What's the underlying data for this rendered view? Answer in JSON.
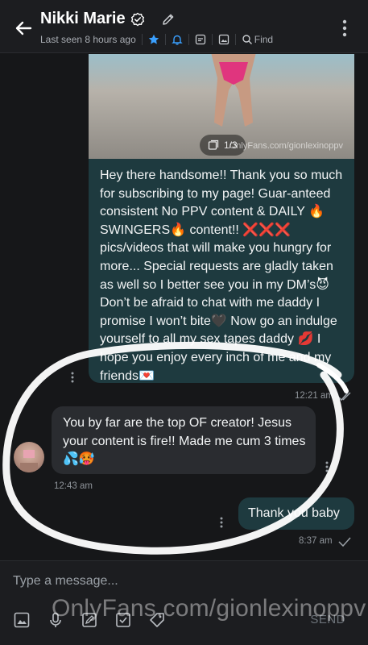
{
  "header": {
    "title": "Nikki Marie",
    "last_seen": "Last seen 8 hours ago",
    "find_label": "Find"
  },
  "media": {
    "counter": "1/3",
    "watermark": "OnlyFans.com/gionlexinoppv"
  },
  "messages": [
    {
      "direction": "outgoing",
      "text": "Hey there handsome!! Thank you so much for subscribing to my page! Guar-anteed consistent No PPV content & DAILY 🔥SWINGERS🔥 content!! ❌❌❌ pics/videos that will make you hungry for more... Special requests are gladly taken as well so I better see you in my DM’s😈 Don’t be afraid to chat with me daddy I promise I won’t bite🖤 Now go an indulge yourself to all my sex tapes daddy 💋 I hope you enjoy every inch of me and my friends💌",
      "time": "12:21 am"
    },
    {
      "direction": "incoming",
      "text": "You by far are the top OF creator! Jesus your content is fire!! Made me cum 3 times💦🥵",
      "time": "12:43 am"
    },
    {
      "direction": "outgoing",
      "text": "Thank you baby",
      "time": "8:37 am"
    }
  ],
  "composer": {
    "placeholder": "Type a message...",
    "send_label": "SEND"
  },
  "overlay_watermark": "OnlyFans.com/gionlexinoppv",
  "colors": {
    "background": "#161719",
    "outgoing_bubble": "#1e3a3f",
    "incoming_bubble": "#2a2c30",
    "accent": "#3aa0ff"
  },
  "icons": [
    "back-arrow-icon",
    "verified-icon",
    "edit-pencil-icon",
    "star-icon",
    "bell-icon",
    "media-gallery-icon",
    "image-icon",
    "search-icon",
    "more-vertical-icon",
    "image-attach-icon",
    "microphone-icon",
    "note-icon",
    "checklist-icon",
    "price-tag-icon"
  ]
}
